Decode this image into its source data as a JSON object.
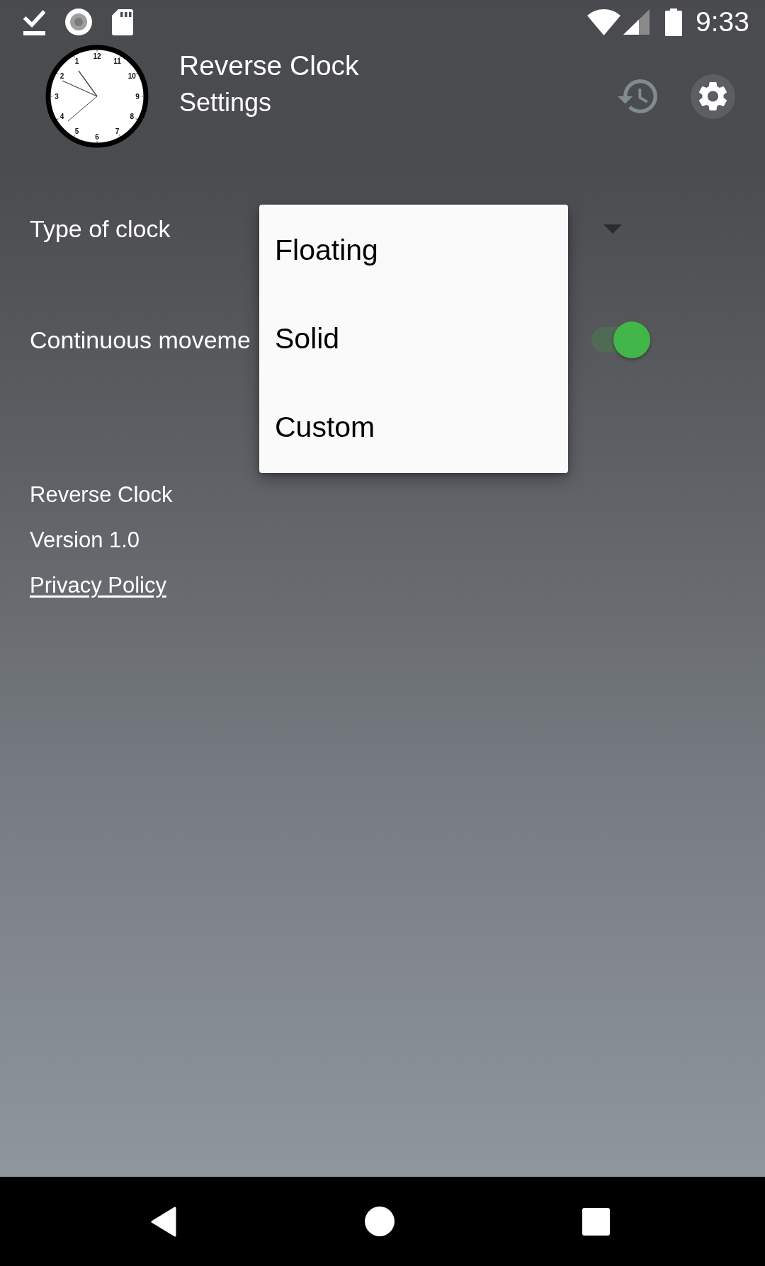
{
  "status_bar": {
    "time": "9:33"
  },
  "header": {
    "logo_numerals": [
      "12",
      "11",
      "10",
      "9",
      "8",
      "7",
      "6",
      "5",
      "4",
      "3",
      "2",
      "1"
    ],
    "title": "Reverse Clock",
    "subtitle": "Settings"
  },
  "settings": [
    {
      "kind": "dropdown",
      "label": "Type of clock"
    },
    {
      "kind": "switch",
      "label": "Continuous moveme",
      "on": true
    }
  ],
  "dropdown_menu": {
    "items": [
      {
        "label": "Floating"
      },
      {
        "label": "Solid"
      },
      {
        "label": "Custom"
      }
    ]
  },
  "about": {
    "app_name": "Reverse Clock",
    "version": "Version 1.0",
    "privacy_link": "Privacy Policy"
  }
}
